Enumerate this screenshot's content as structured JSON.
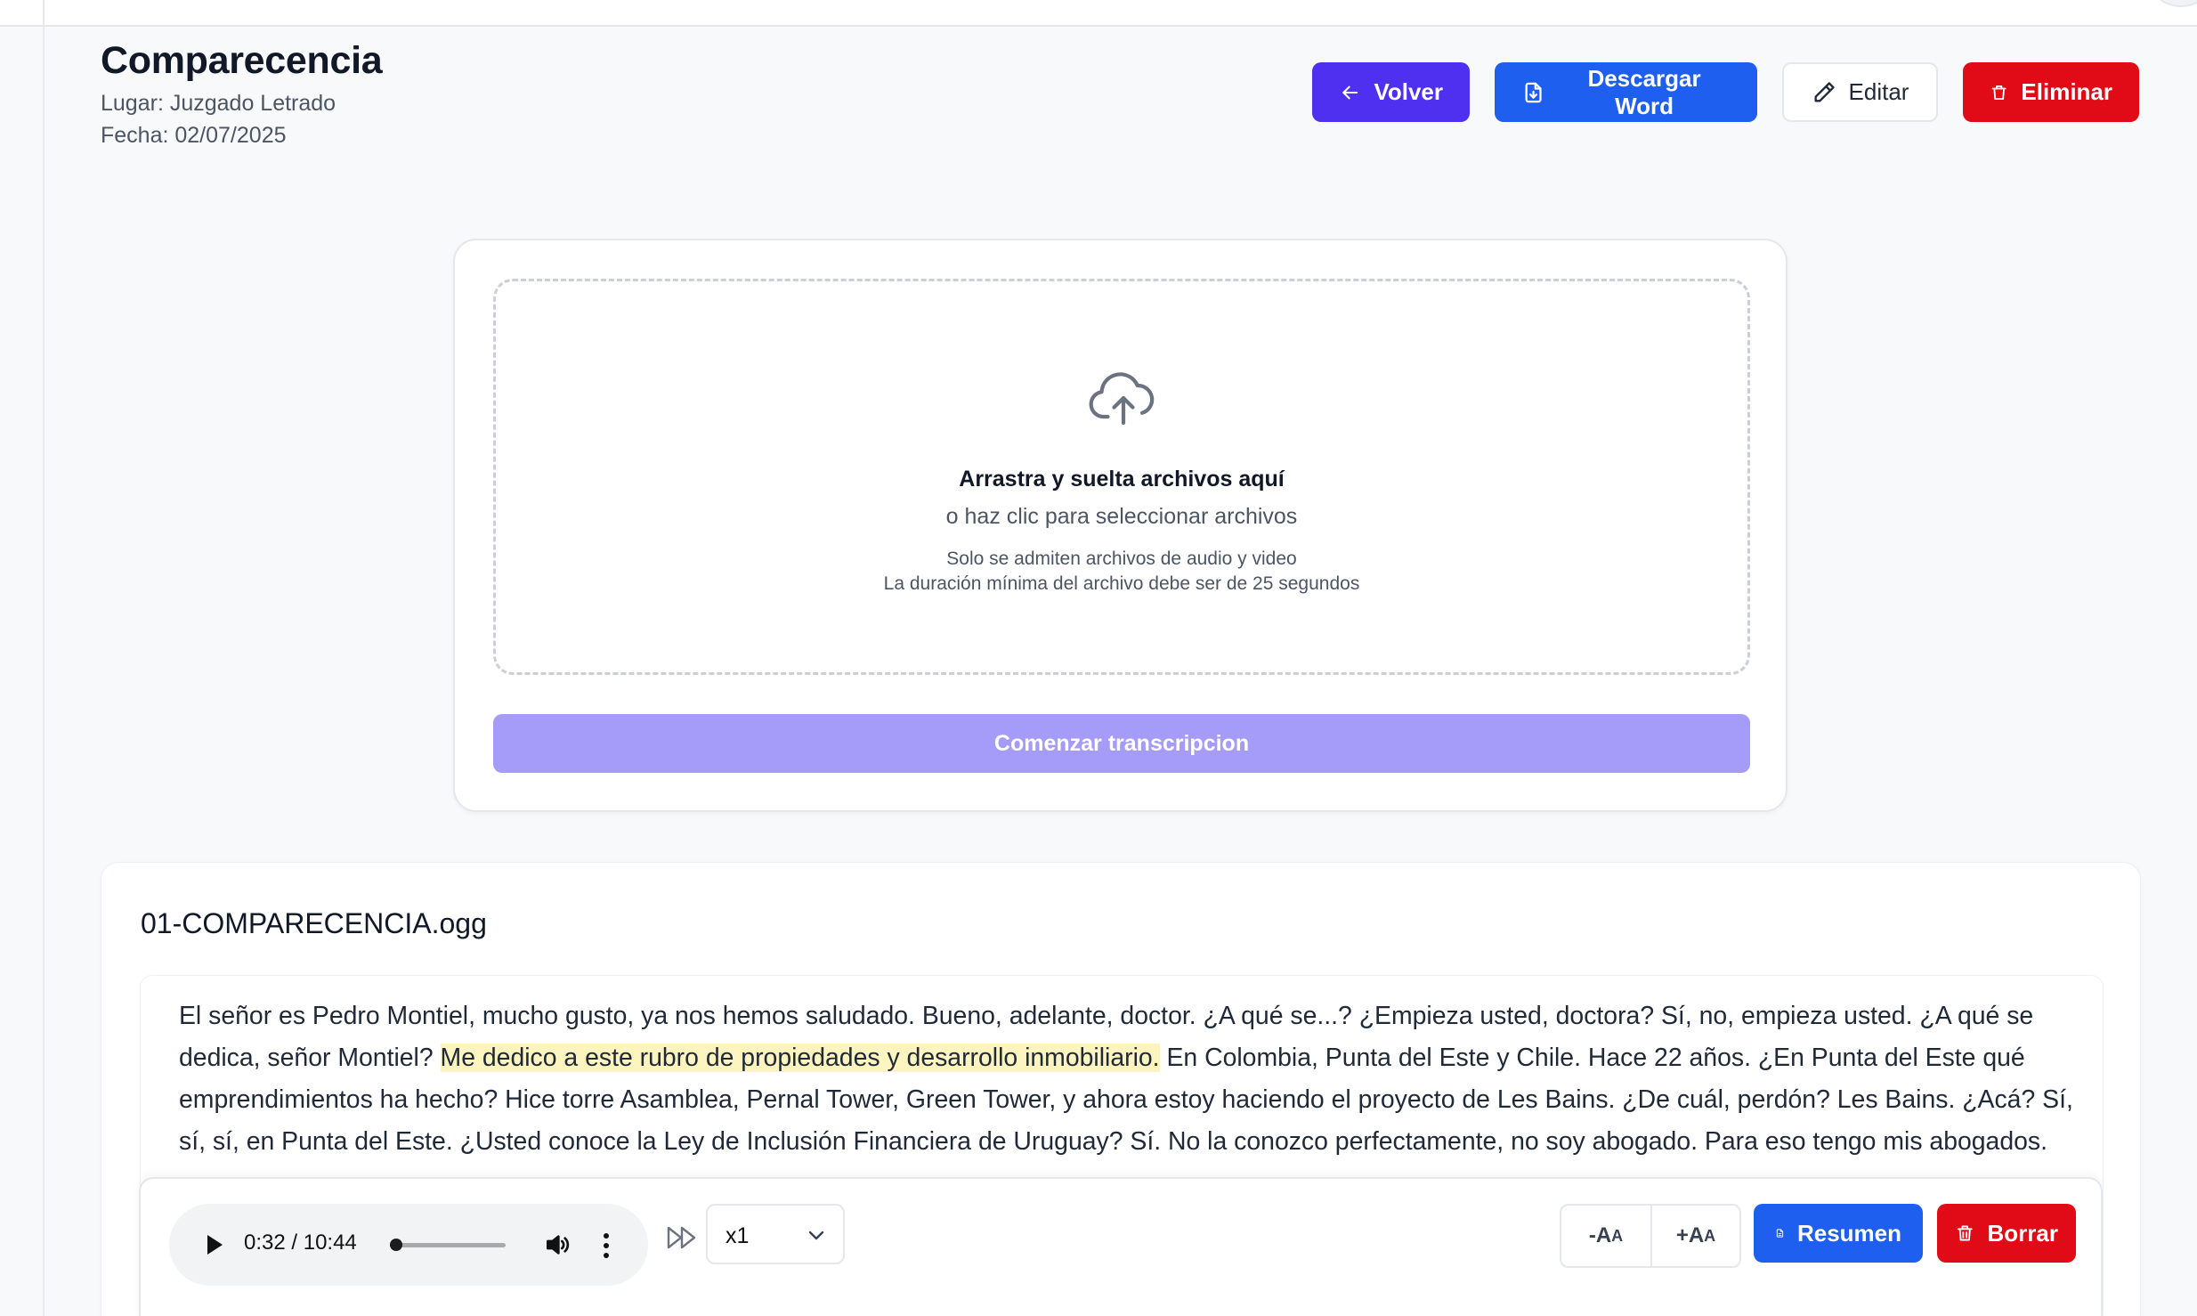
{
  "header": {
    "title": "Comparecencia",
    "place": "Lugar: Juzgado Letrado",
    "date": "Fecha: 02/07/2025"
  },
  "actions": {
    "back_label": "Volver",
    "download_label": "Descargar Word",
    "edit_label": "Editar",
    "delete_label": "Eliminar"
  },
  "upload": {
    "title": "Arrastra y suelta archivos aquí",
    "subtitle": "o haz clic para seleccionar archivos",
    "note_formats": "Solo se admiten archivos de audio y video",
    "note_duration": "La duración mínima del archivo debe ser de 25 segundos",
    "start_label": "Comenzar transcripcion"
  },
  "file": {
    "name": "01-COMPARECENCIA.ogg",
    "transcript_before": "El señor es Pedro Montiel, mucho gusto, ya nos hemos saludado. Bueno, adelante, doctor. ¿A qué se...? ¿Empieza usted, doctora? Sí, no, empieza usted. ¿A qué se dedica, señor Montiel? ",
    "transcript_highlight": "Me dedico a este rubro de propiedades y desarrollo inmobiliario.",
    "transcript_after": " En Colombia, Punta del Este y Chile. Hace 22 años. ¿En Punta del Este qué emprendimientos ha hecho? Hice torre Asamblea, Pernal Tower, Green Tower, y ahora estoy haciendo el proyecto de Les Bains. ¿De cuál, perdón? Les Bains. ¿Acá? Sí, sí, sí, en Punta del Este. ¿Usted conoce la Ley de Inclusión Financiera de Uruguay? Sí. No la conozco perfectamente, no soy abogado. Para eso tengo mis abogados."
  },
  "player": {
    "time": "0:32 / 10:44",
    "progress_fraction": 0.051,
    "speed": "x1",
    "font_decrease": "-A",
    "font_increase": "+A",
    "font_glyph_small": "A",
    "summary_label": "Resumen",
    "clear_label": "Borrar"
  },
  "colors": {
    "primary_violet": "#4f2ff0",
    "primary_blue": "#1f5ff0",
    "danger_red": "#e00b16",
    "disabled_violet": "#a49cf8",
    "highlight_yellow": "#fdf4bf"
  }
}
